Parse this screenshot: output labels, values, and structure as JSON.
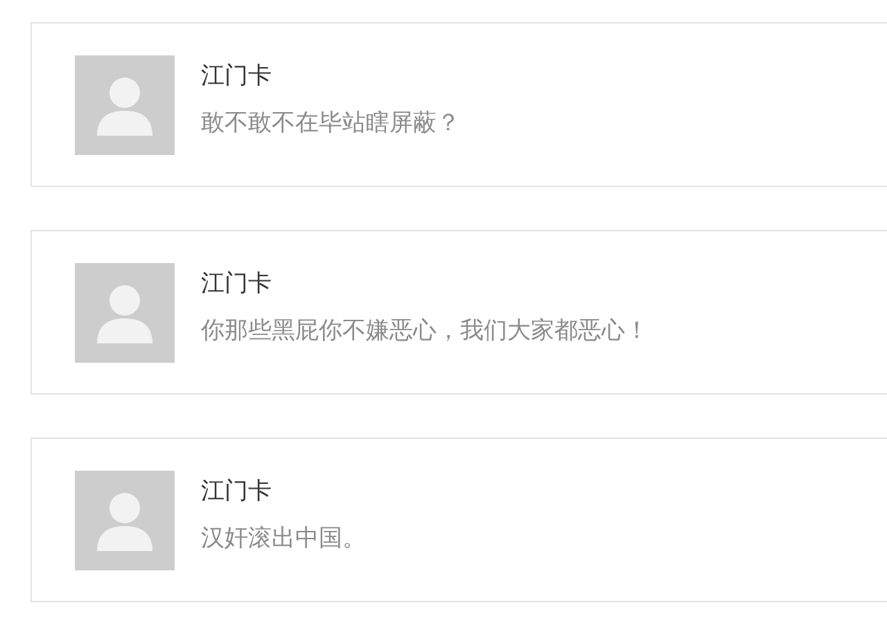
{
  "comments": [
    {
      "author": "江门卡",
      "text": "敢不敢不在毕站瞎屏蔽？"
    },
    {
      "author": "江门卡",
      "text": "你那些黑屁你不嫌恶心，我们大家都恶心！"
    },
    {
      "author": "江门卡",
      "text": "汉奸滚出中国。"
    }
  ]
}
